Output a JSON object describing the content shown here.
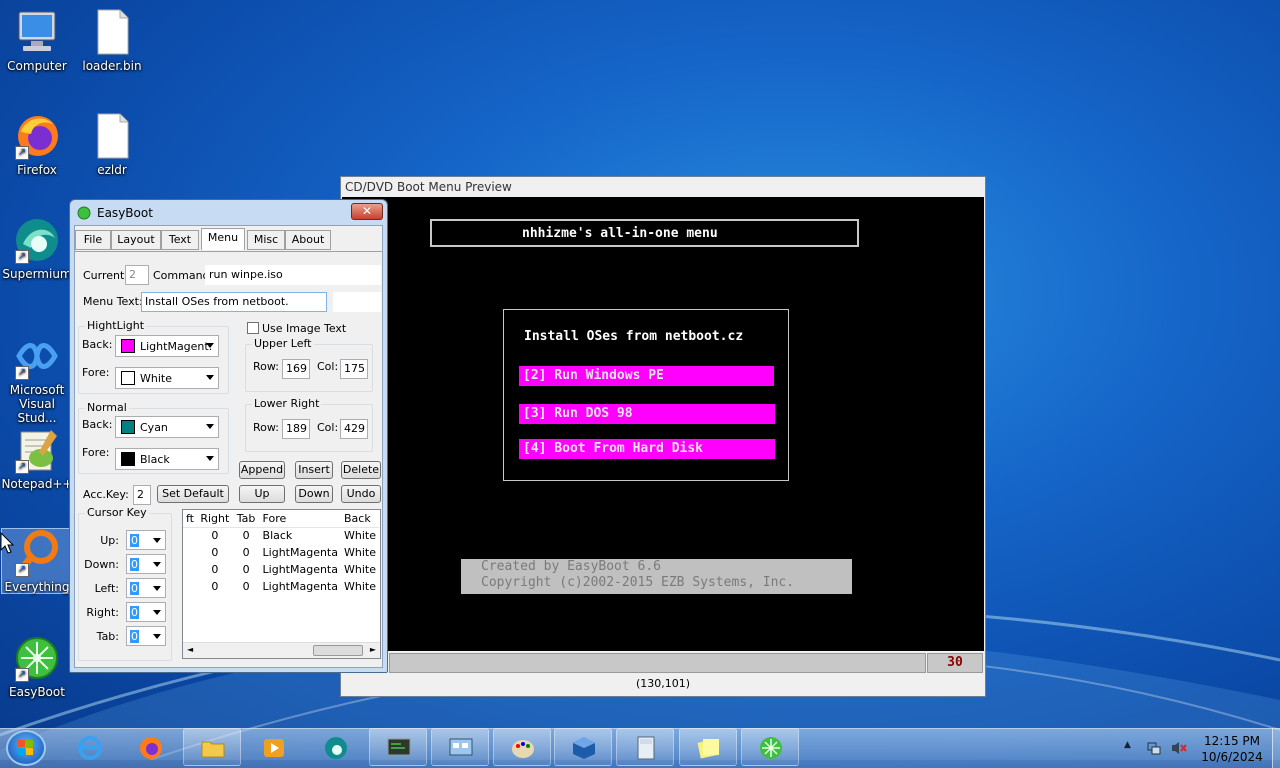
{
  "desktop": {
    "icons": [
      {
        "label": "Computer",
        "icon": "computer-icon"
      },
      {
        "label": "loader.bin",
        "icon": "file-icon"
      },
      {
        "label": "Firefox",
        "icon": "firefox-icon"
      },
      {
        "label": "ezldr",
        "icon": "file-icon"
      },
      {
        "label": "Supermium",
        "icon": "supermium-icon"
      },
      {
        "label": "Microsoft Visual Stud...",
        "icon": "visual-studio-icon"
      },
      {
        "label": "Notepad++",
        "icon": "notepadpp-icon"
      },
      {
        "label": "Everything",
        "icon": "everything-icon"
      },
      {
        "label": "EasyBoot",
        "icon": "easyboot-icon"
      }
    ]
  },
  "easyboot": {
    "title": "EasyBoot",
    "tabs": [
      "File",
      "Layout",
      "Text",
      "Menu",
      "Misc",
      "About"
    ],
    "active_tab": "Menu",
    "current_label": "Current:",
    "current_value": "2",
    "command_label": "Command:",
    "command_value": "run winpe.iso",
    "menutext_label": "Menu Text:",
    "menutext_value": "Install OSes from netboot.",
    "highlight": {
      "title": "HightLight",
      "back_label": "Back:",
      "back_value": "LightMagent.",
      "back_color": "#ff00ff",
      "fore_label": "Fore:",
      "fore_value": "White",
      "fore_color": "#ffffff"
    },
    "normal": {
      "title": "Normal",
      "back_label": "Back:",
      "back_value": "Cyan",
      "back_color": "#008080",
      "fore_label": "Fore:",
      "fore_value": "Black",
      "fore_color": "#000000"
    },
    "use_image_text": "Use Image Text",
    "upper_left": {
      "title": "Upper Left",
      "row_label": "Row:",
      "row": "169",
      "col_label": "Col:",
      "col": "175"
    },
    "lower_right": {
      "title": "Lower Right",
      "row_label": "Row:",
      "row": "189",
      "col_label": "Col:",
      "col": "429"
    },
    "buttons": {
      "append": "Append",
      "insert": "Insert",
      "delete": "Delete",
      "set_default": "Set Default",
      "up": "Up",
      "down": "Down",
      "undo": "Undo"
    },
    "acckey_label": "Acc.Key:",
    "acckey_value": "2",
    "cursor": {
      "title": "Cursor Key",
      "up": "Up:",
      "down": "Down:",
      "left": "Left:",
      "right": "Right:",
      "tab": "Tab:",
      "value": "0"
    },
    "table": {
      "headers": [
        "ft",
        "Right",
        "Tab",
        "Fore",
        "Back"
      ],
      "rows": [
        [
          "",
          "0",
          "0",
          "Black",
          "White"
        ],
        [
          "",
          "0",
          "0",
          "LightMagenta",
          "White"
        ],
        [
          "",
          "0",
          "0",
          "LightMagenta",
          "White"
        ],
        [
          "",
          "0",
          "0",
          "LightMagenta",
          "White"
        ]
      ]
    }
  },
  "preview": {
    "title": "CD/DVD Boot Menu Preview",
    "header": "nhhizme's all-in-one menu",
    "menu_title": "Install OSes from netboot.cz",
    "items": [
      "[2] Run Windows PE",
      "[3] Run DOS 98",
      "[4] Boot From Hard Disk"
    ],
    "footer1": "Created by EasyBoot 6.6",
    "footer2": "Copyright (c)2002-2015 EZB Systems, Inc.",
    "countdown": "30",
    "coords": "(130,101)",
    "item_color": "#ff00ff"
  },
  "taskbar": {
    "time": "12:15 PM",
    "date": "10/6/2024"
  }
}
